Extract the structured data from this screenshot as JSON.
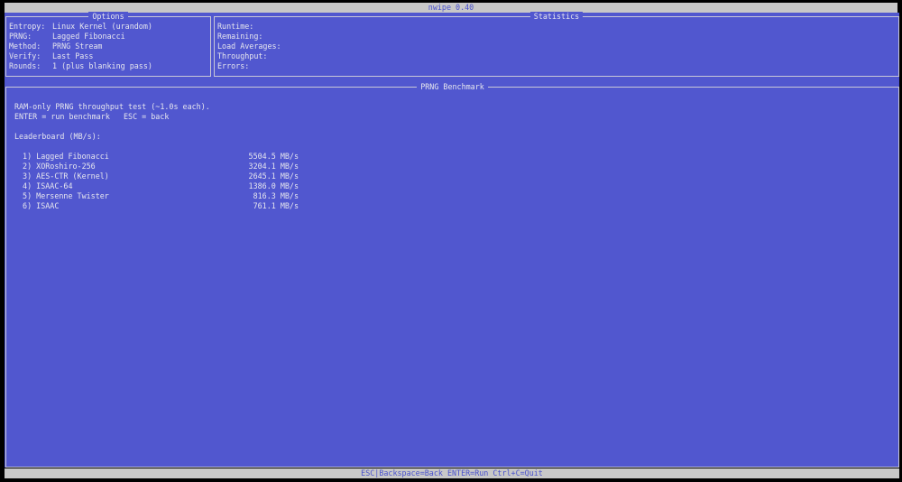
{
  "title": "nwipe 0.40",
  "options": {
    "title": "Options",
    "rows": [
      {
        "label": "Entropy:",
        "value": "Linux Kernel (urandom)"
      },
      {
        "label": "PRNG:",
        "value": "Lagged Fibonacci"
      },
      {
        "label": "Method:",
        "value": "PRNG Stream"
      },
      {
        "label": "Verify:",
        "value": "Last Pass"
      },
      {
        "label": "Rounds:",
        "value": "1 (plus blanking pass)"
      }
    ]
  },
  "statistics": {
    "title": "Statistics",
    "rows": [
      "Runtime:",
      "Remaining:",
      "Load Averages:",
      "Throughput:",
      "Errors:"
    ]
  },
  "benchmark": {
    "title": "PRNG Benchmark",
    "intro_line1": "RAM-only PRNG throughput test (~1.0s each).",
    "intro_line2": "ENTER = run benchmark   ESC = back",
    "leaderboard_title": "Leaderboard (MB/s):",
    "leaderboard": [
      {
        "name": " 1) Lagged Fibonacci",
        "value": "5504.5 MB/s"
      },
      {
        "name": " 2) XORoshiro-256",
        "value": "3204.1 MB/s"
      },
      {
        "name": " 3) AES-CTR (Kernel)",
        "value": "2645.1 MB/s"
      },
      {
        "name": " 4) ISAAC-64",
        "value": "1386.0 MB/s"
      },
      {
        "name": " 5) Mersenne Twister",
        "value": "816.3 MB/s"
      },
      {
        "name": " 6) ISAAC",
        "value": "761.1 MB/s"
      }
    ]
  },
  "footer": "ESC|Backspace=Back ENTER=Run Ctrl+C=Quit"
}
